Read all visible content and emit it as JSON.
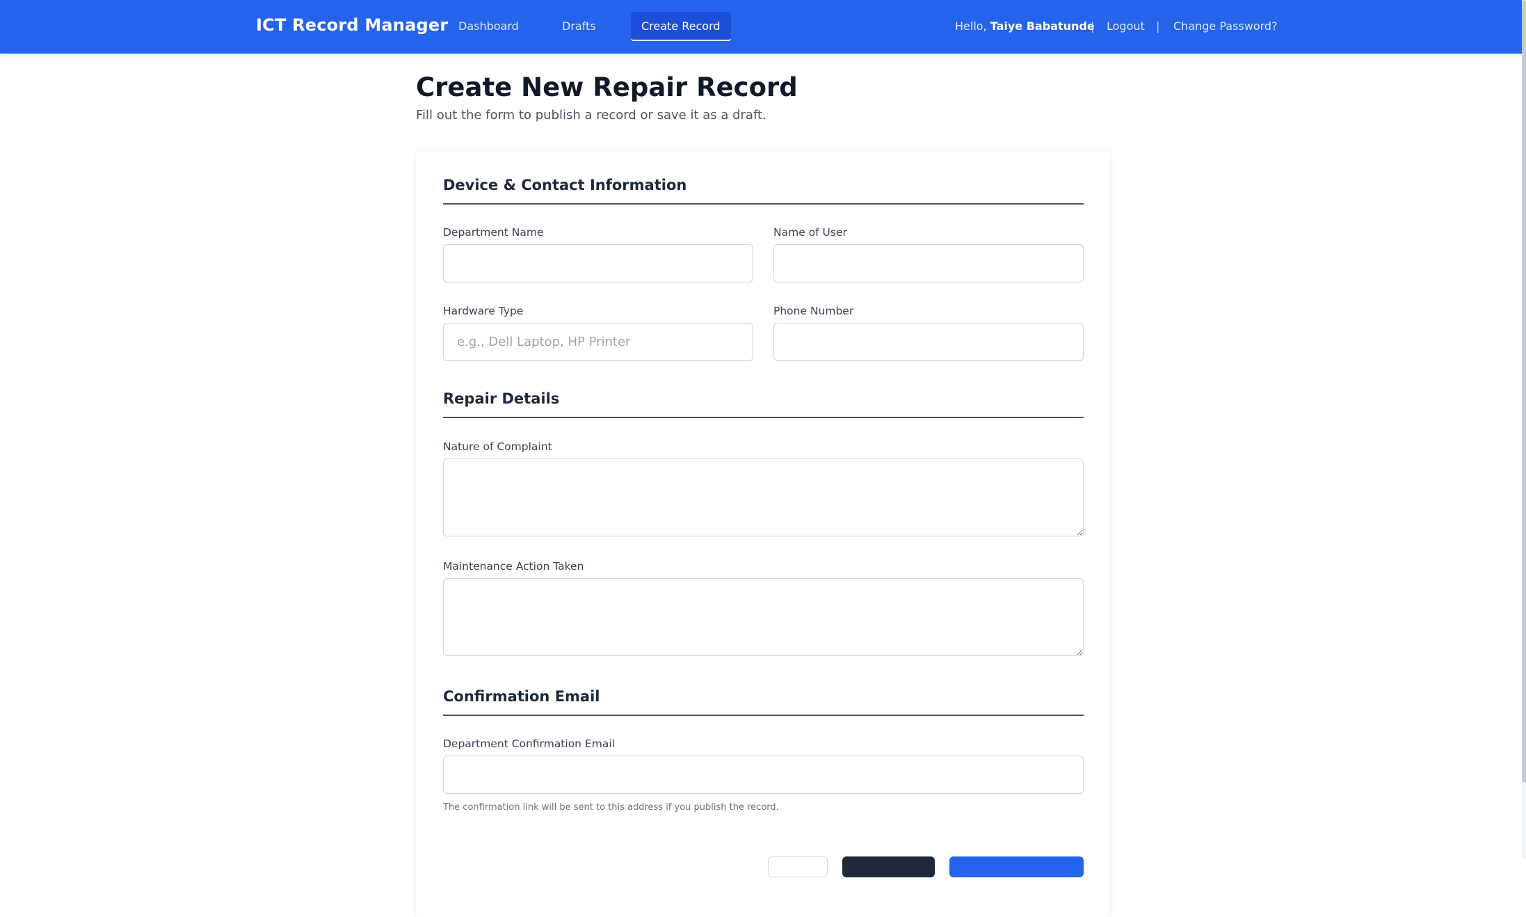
{
  "nav": {
    "brand": "ICT Record Manager",
    "links": [
      {
        "label": "Dashboard"
      },
      {
        "label": "Drafts"
      },
      {
        "label": "Create Record"
      }
    ],
    "greeting": "Hello,",
    "user_name": "Taiye Babatunde",
    "separator": "|",
    "logout": "Logout",
    "change_password": "Change Password?"
  },
  "page": {
    "title": "Create New Repair Record",
    "subtitle": "Fill out the form to publish a record or save it as a draft."
  },
  "sections": {
    "device": {
      "title": "Device & Contact Information",
      "department_name": {
        "label": "Department Name",
        "value": "",
        "placeholder": ""
      },
      "user_name": {
        "label": "Name of User",
        "value": "",
        "placeholder": ""
      },
      "hardware_type": {
        "label": "Hardware Type",
        "value": "",
        "placeholder": "e.g., Dell Laptop, HP Printer"
      },
      "phone_number": {
        "label": "Phone Number",
        "value": "",
        "placeholder": ""
      }
    },
    "repair": {
      "title": "Repair Details",
      "complaint": {
        "label": "Nature of Complaint",
        "value": ""
      },
      "action": {
        "label": "Maintenance Action Taken",
        "value": ""
      }
    },
    "confirmation": {
      "title": "Confirmation Email",
      "email": {
        "label": "Department Confirmation Email",
        "value": ""
      },
      "hint": "The confirmation link will be sent to this address if you publish the record."
    }
  },
  "colors": {
    "nav_bg": "#2563eb",
    "active_tab_bg": "#1d4ed8",
    "dark_button": "#1f2937",
    "primary_button": "#2563eb"
  }
}
